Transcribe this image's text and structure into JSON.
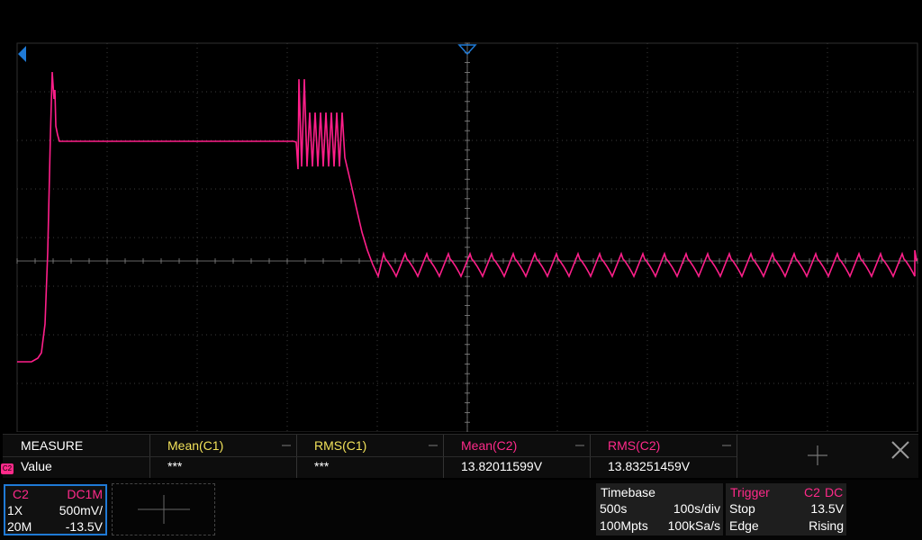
{
  "colors": {
    "trace": "#ff1f8a",
    "grid": "#3c3c3c",
    "axis": "#888888",
    "accent_blue": "#1f7ad6",
    "yellow": "#f2e25a"
  },
  "measure": {
    "title": "MEASURE",
    "row_label": "Value",
    "items": [
      {
        "label": "Mean(C1)",
        "value": "***",
        "color": "#f2e25a"
      },
      {
        "label": "RMS(C1)",
        "value": "***",
        "color": "#f2e25a"
      },
      {
        "label": "Mean(C2)",
        "value": "13.82011599V",
        "color": "#ff2a8a"
      },
      {
        "label": "RMS(C2)",
        "value": "13.83251459V",
        "color": "#ff2a8a"
      }
    ]
  },
  "channel": {
    "name": "C2",
    "coupling": "DC1M",
    "probe": "1X",
    "scale": "500mV/",
    "bandwidth": "20M",
    "offset": "-13.5V",
    "badge": "C2"
  },
  "timebase": {
    "title": "Timebase",
    "delay": "500s",
    "scale": "100s/div",
    "memory": "100Mpts",
    "sample_rate": "100kSa/s"
  },
  "trigger": {
    "title": "Trigger",
    "source": "C2",
    "coupling": "DC",
    "mode": "Stop",
    "level": "13.5V",
    "type": "Edge",
    "slope": "Rising"
  },
  "icons": [
    "close-icon",
    "plus-icon",
    "trigger-position-icon",
    "channel-level-icon"
  ]
}
